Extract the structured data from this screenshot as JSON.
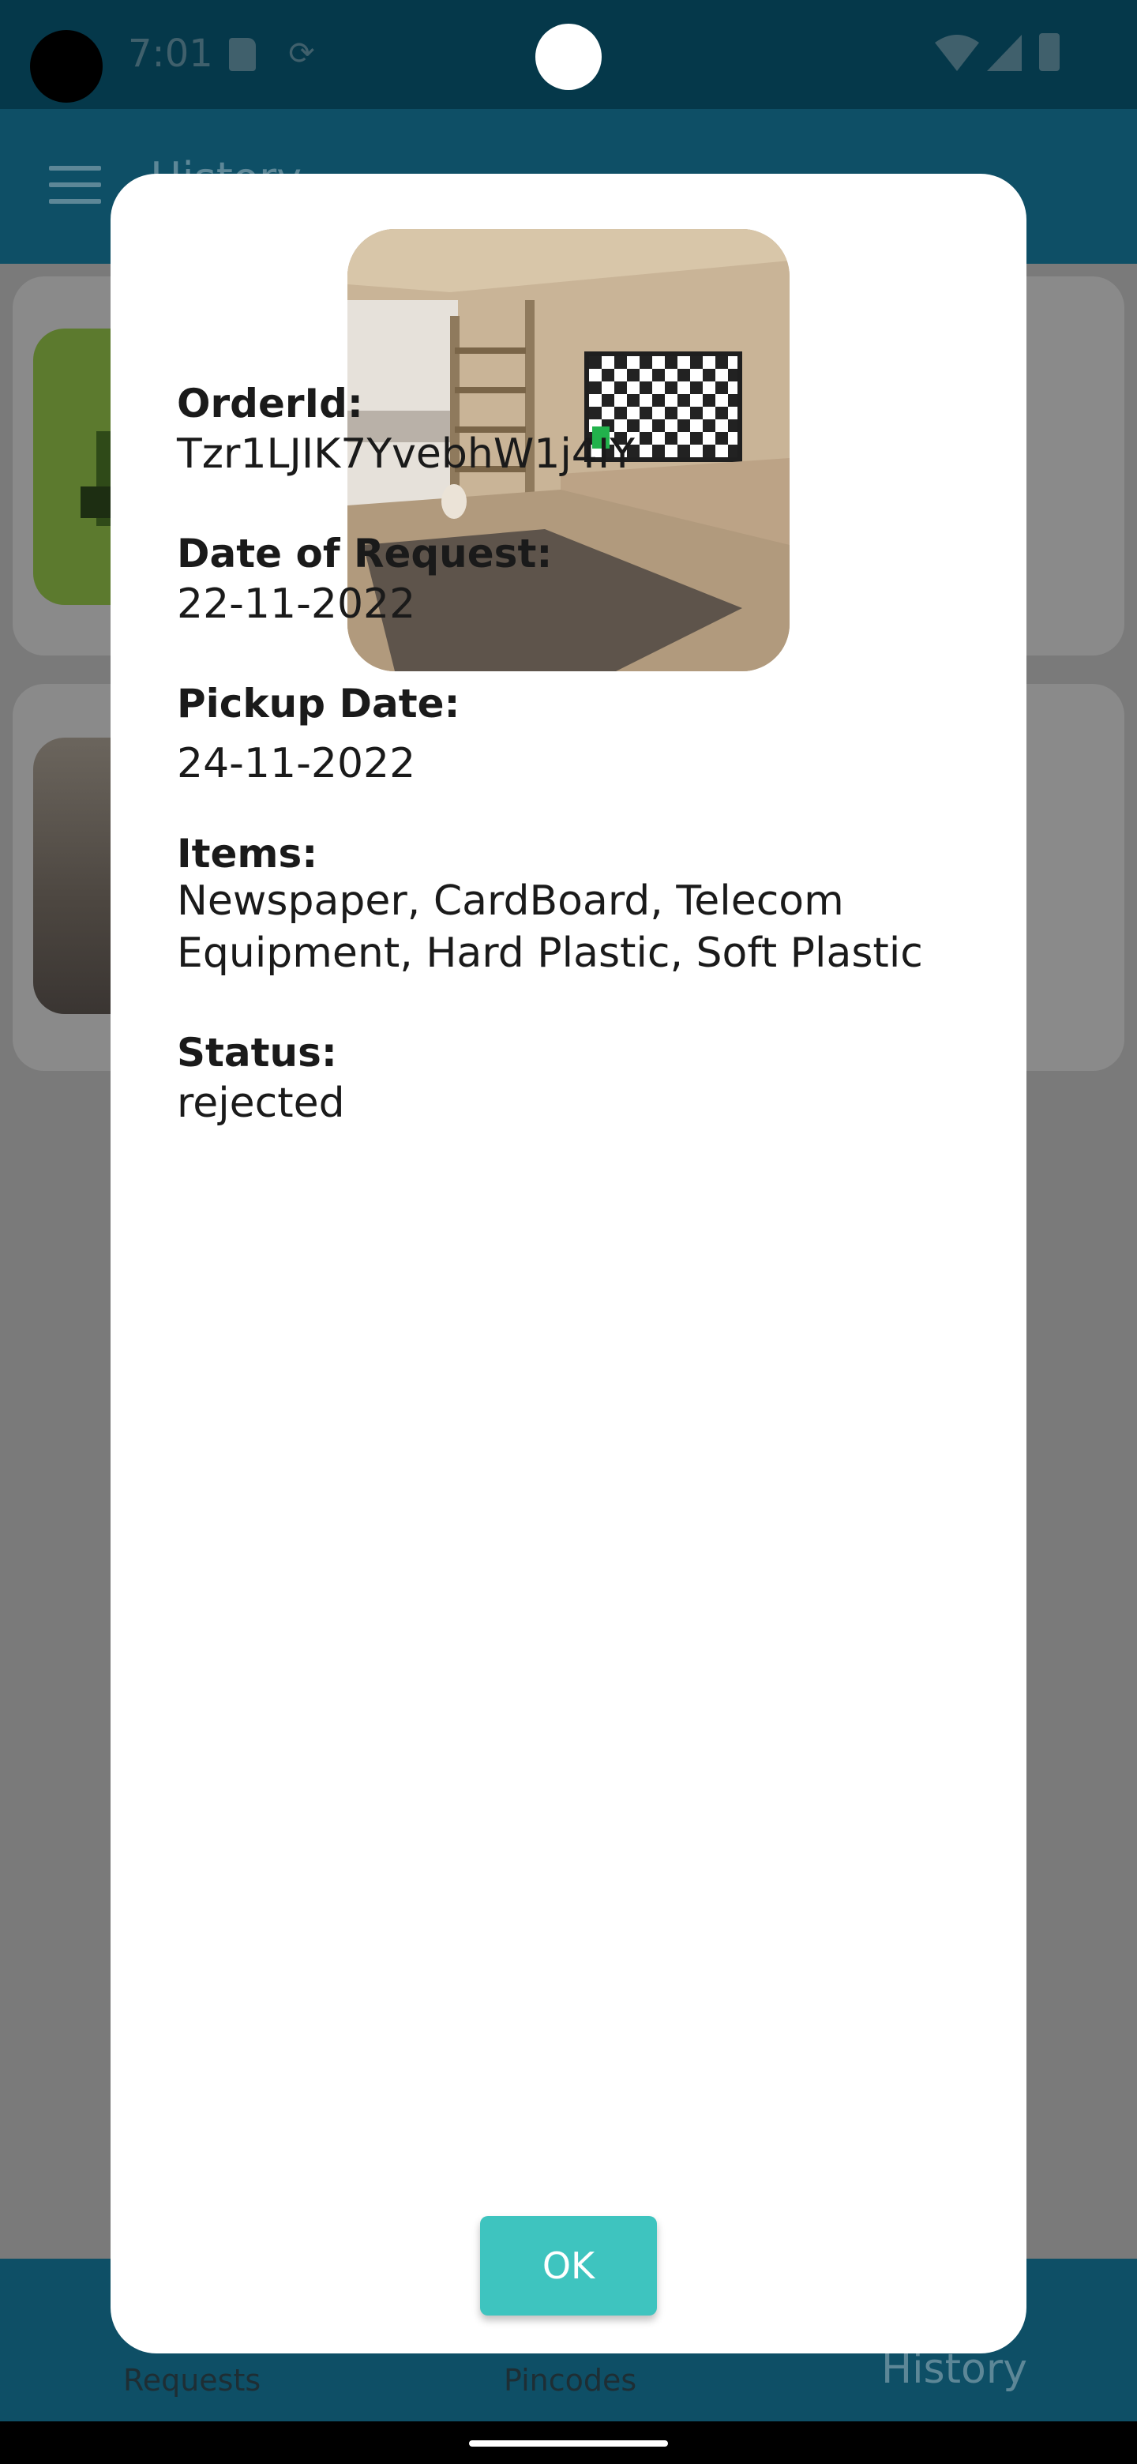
{
  "status_bar": {
    "time": "7:01"
  },
  "app_bar": {
    "title": "History"
  },
  "dialog": {
    "fields": [
      {
        "label": "OrderId:",
        "value": "Tzr1LJIK7YvebhW1j4IY"
      },
      {
        "label": "Date of Request:",
        "value": "22-11-2022"
      },
      {
        "label": "Pickup Date:",
        "value": "24-11-2022"
      },
      {
        "label": "Items:",
        "value": "Newspaper, CardBoard, Telecom Equipment, Hard Plastic, Soft Plastic"
      },
      {
        "label": "Status:",
        "value": "rejected"
      }
    ],
    "ok_label": "OK"
  },
  "bottom_nav": {
    "requests": "Requests",
    "pincodes": "Pincodes",
    "history": "History"
  },
  "colors": {
    "app_bar": "#0e4f66",
    "ok_button": "#3ec4bf",
    "status_bar": "#05384a"
  }
}
